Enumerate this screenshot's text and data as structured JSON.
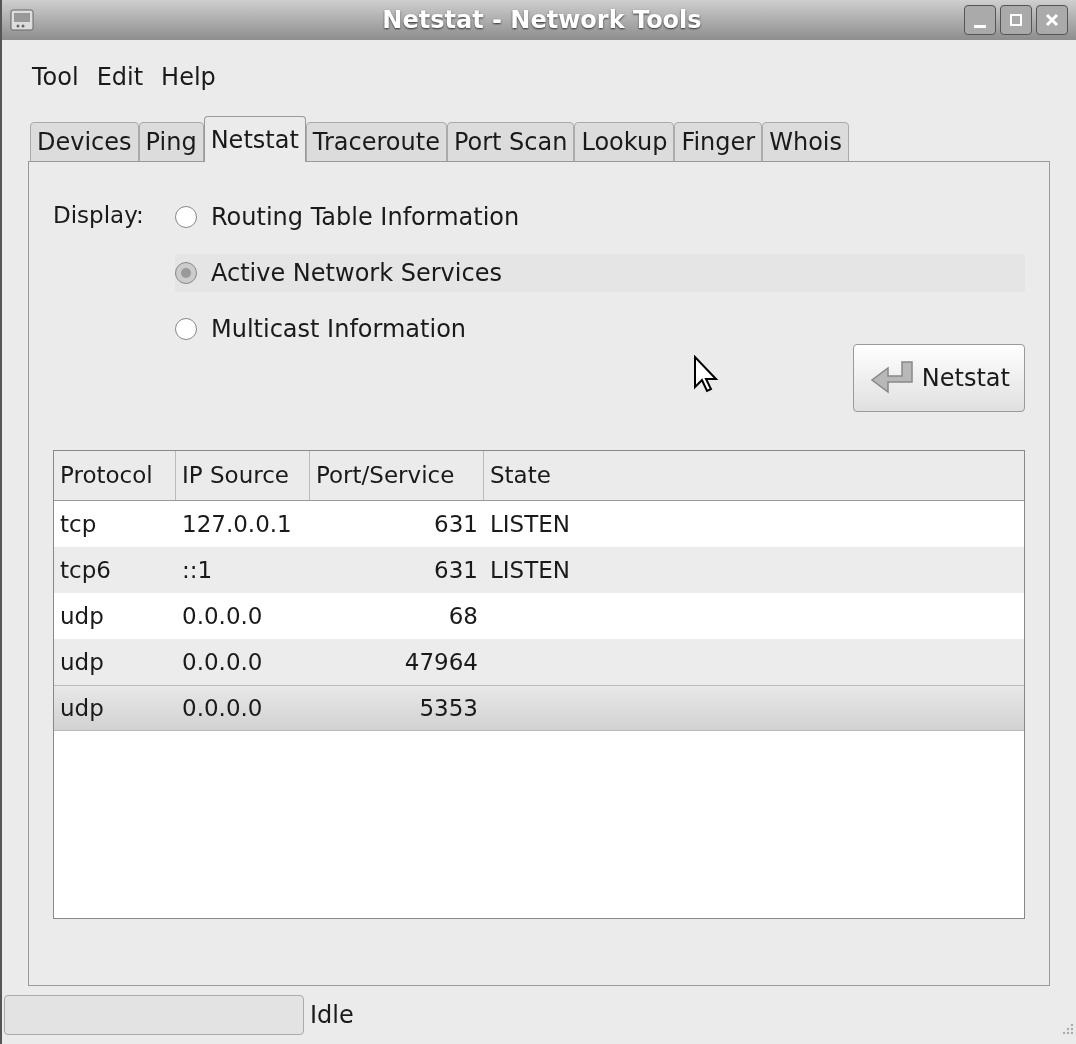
{
  "window": {
    "title": "Netstat - Network Tools"
  },
  "menu": [
    "Tool",
    "Edit",
    "Help"
  ],
  "tabs": [
    {
      "label": "Devices",
      "selected": false
    },
    {
      "label": "Ping",
      "selected": false
    },
    {
      "label": "Netstat",
      "selected": true
    },
    {
      "label": "Traceroute",
      "selected": false
    },
    {
      "label": "Port Scan",
      "selected": false
    },
    {
      "label": "Lookup",
      "selected": false
    },
    {
      "label": "Finger",
      "selected": false
    },
    {
      "label": "Whois",
      "selected": false
    }
  ],
  "display": {
    "label": "Display:",
    "options": [
      {
        "label": "Routing Table Information",
        "selected": false
      },
      {
        "label": "Active Network Services",
        "selected": true
      },
      {
        "label": "Multicast Information",
        "selected": false
      }
    ]
  },
  "action_button": "Netstat",
  "table": {
    "columns": [
      "Protocol",
      "IP Source",
      "Port/Service",
      "State"
    ],
    "rows": [
      {
        "cells": [
          "tcp",
          "127.0.0.1",
          "631",
          "LISTEN"
        ],
        "selected": false
      },
      {
        "cells": [
          "tcp6",
          "::1",
          "631",
          "LISTEN"
        ],
        "selected": false
      },
      {
        "cells": [
          "udp",
          "0.0.0.0",
          "68",
          ""
        ],
        "selected": false
      },
      {
        "cells": [
          "udp",
          "0.0.0.0",
          "47964",
          ""
        ],
        "selected": false
      },
      {
        "cells": [
          "udp",
          "0.0.0.0",
          "5353",
          ""
        ],
        "selected": true
      }
    ]
  },
  "status_bar": {
    "text": "Idle"
  }
}
